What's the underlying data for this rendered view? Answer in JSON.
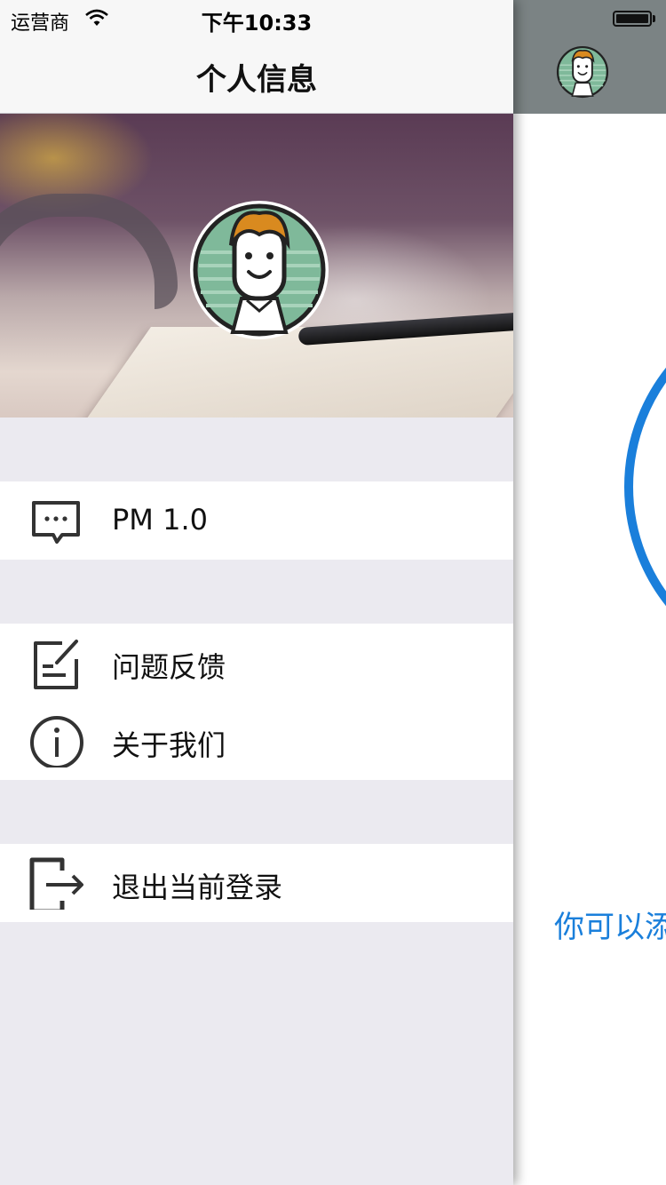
{
  "status_bar": {
    "carrier": "运营商",
    "time": "下午10:33"
  },
  "drawer": {
    "title": "个人信息",
    "menu_groups": [
      {
        "items": [
          {
            "label": "PM 1.0",
            "icon": "message-icon"
          }
        ]
      },
      {
        "items": [
          {
            "label": "问题反馈",
            "icon": "feedback-icon"
          },
          {
            "label": "关于我们",
            "icon": "info-icon"
          }
        ]
      },
      {
        "items": [
          {
            "label": "退出当前登录",
            "icon": "logout-icon"
          }
        ]
      }
    ]
  },
  "main": {
    "hint_text": "你可以添"
  },
  "colors": {
    "accent_blue": "#1a7fdb",
    "background": "#ebeaf0",
    "avatar_green": "#7fb99a",
    "avatar_hair": "#d98a1f"
  }
}
